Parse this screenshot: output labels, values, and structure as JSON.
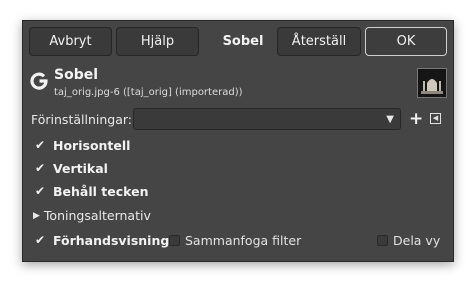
{
  "buttons": {
    "cancel": "Avbryt",
    "help": "Hjälp",
    "tool": "Sobel",
    "reset": "Återställ",
    "ok": "OK"
  },
  "header": {
    "icon": "gegl-g-icon",
    "title": "Sobel",
    "subtitle": "taj_orig.jpg-6 ([taj_orig] (importerad))"
  },
  "presets": {
    "label": "Förinställningar:",
    "value": ""
  },
  "options": {
    "horizontal": {
      "label": "Horisontell",
      "checked": true
    },
    "vertical": {
      "label": "Vertikal",
      "checked": true
    },
    "keep_sign": {
      "label": "Behåll tecken",
      "checked": true
    }
  },
  "blending": {
    "label": "Toningsalternativ"
  },
  "footer": {
    "preview": {
      "label": "Förhandsvisning",
      "checked": true
    },
    "merge": {
      "label": "Sammanfoga filter",
      "checked": false
    },
    "split": {
      "label": "Dela vy",
      "checked": false
    }
  }
}
